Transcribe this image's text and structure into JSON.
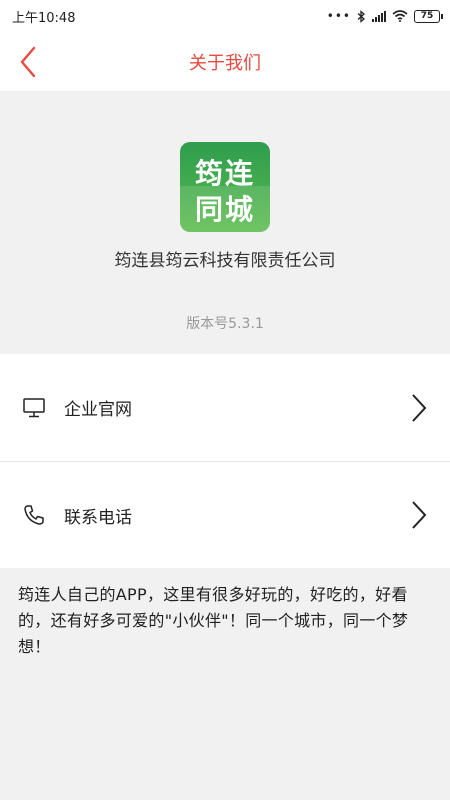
{
  "status_bar": {
    "time": "上午10:48",
    "battery": "75",
    "icons": [
      "dots-icon",
      "bluetooth-icon",
      "signal-icon",
      "wifi-icon",
      "battery-icon"
    ]
  },
  "nav": {
    "title": "关于我们",
    "back_icon": "chevron-left-icon"
  },
  "about": {
    "logo_text_top": "筠连",
    "logo_text_bottom": "同城",
    "company": "筠连县筠云科技有限责任公司",
    "version": "版本号5.3.1"
  },
  "menu": {
    "items": [
      {
        "label": "企业官网",
        "icon": "monitor-icon"
      },
      {
        "label": "联系电话",
        "icon": "phone-icon"
      }
    ]
  },
  "description": "筠连人自己的APP，这里有很多好玩的，好吃的，好看的，还有好多可爱的\"小伙伴\"！同一个城市，同一个梦想！",
  "colors": {
    "accent": "#e84a3f",
    "logo_green": "#3aa84f",
    "background": "#f1f1f1"
  }
}
